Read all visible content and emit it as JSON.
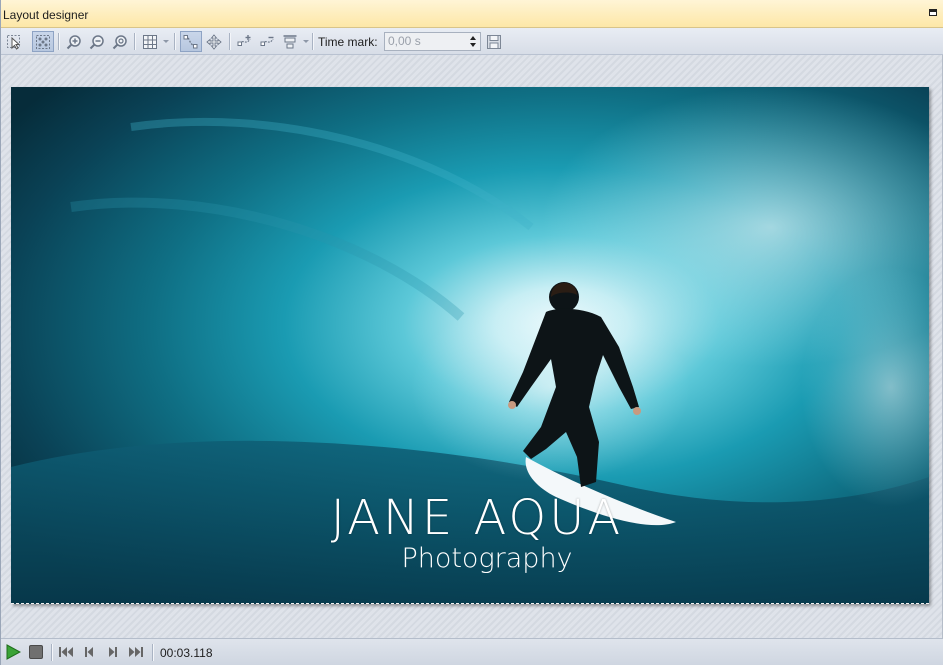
{
  "window": {
    "title": "Layout designer"
  },
  "toolbar": {
    "buttons": [
      {
        "name": "select-tool-icon",
        "active": false
      },
      {
        "name": "multi-select-icon",
        "active": true
      },
      {
        "name": "zoom-in-icon",
        "active": false
      },
      {
        "name": "zoom-out-icon",
        "active": false
      },
      {
        "name": "zoom-fit-icon",
        "active": false
      },
      {
        "name": "grid-icon",
        "active": false
      },
      {
        "name": "animation-path-icon",
        "active": true
      },
      {
        "name": "move-icon",
        "active": false
      },
      {
        "name": "add-keyframe-icon",
        "active": false
      },
      {
        "name": "remove-keyframe-icon",
        "active": false
      },
      {
        "name": "align-icon",
        "active": false
      },
      {
        "name": "save-icon",
        "active": false
      }
    ],
    "time_mark_label": "Time mark:",
    "time_mark_value": "0,00 s"
  },
  "canvas": {
    "logo_title": "JANE AQUA",
    "logo_subtitle": "Photography"
  },
  "transport": {
    "timecode": "00:03.118",
    "colors": {
      "play": "#3aa336",
      "stop": "#707070"
    }
  }
}
